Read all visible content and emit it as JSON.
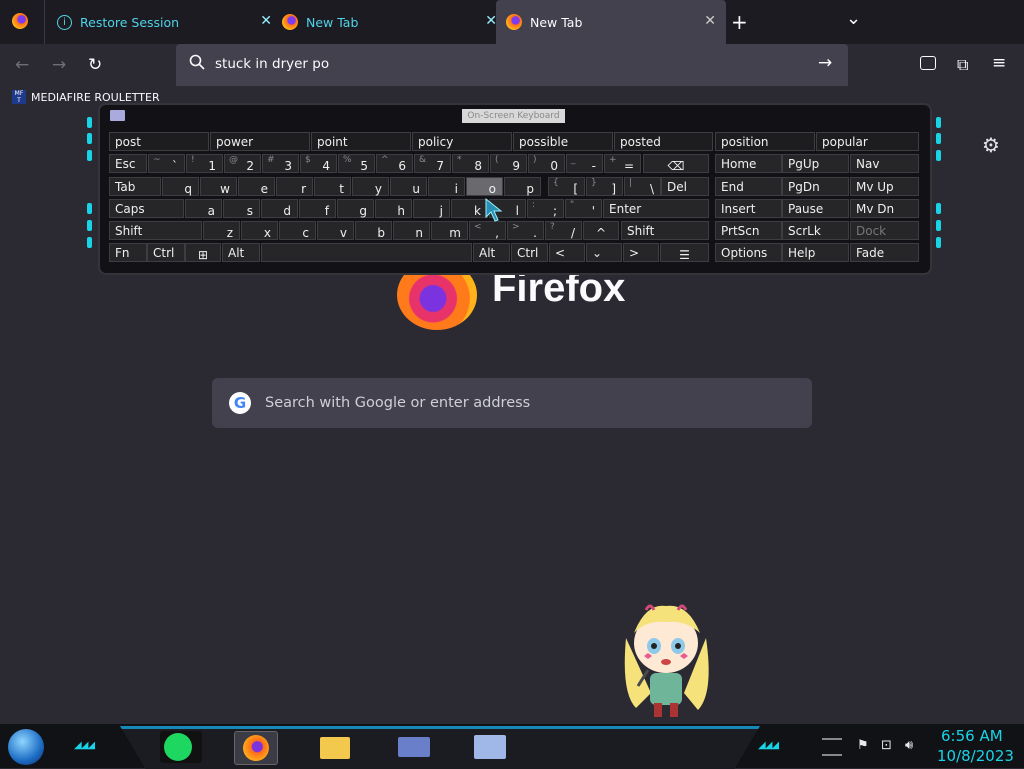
{
  "browser": {
    "tabs": [
      {
        "label": "Restore Session",
        "icon": "info-icon",
        "active": false
      },
      {
        "label": "New Tab",
        "icon": "firefox-icon",
        "active": false
      },
      {
        "label": "New Tab",
        "icon": "firefox-icon",
        "active": true
      }
    ],
    "new_tab": "+",
    "tab_list": "⌄",
    "close_glyph": "✕",
    "address_value": "stuck in dryer po",
    "go_glyph": "→",
    "bookmarks": [
      {
        "label": "MEDIAFIRE ROULETTER",
        "icon_text": "MF T"
      }
    ]
  },
  "keyboard": {
    "title": "On-Screen Keyboard",
    "predictions": [
      "post",
      "power",
      "point",
      "policy",
      "possible",
      "posted",
      "position",
      "popular"
    ],
    "rows": {
      "r1": [
        [
          "~",
          "`"
        ],
        [
          "!",
          "1"
        ],
        [
          "@",
          "2"
        ],
        [
          "#",
          "3"
        ],
        [
          "$",
          "4"
        ],
        [
          "%",
          "5"
        ],
        [
          "^",
          "6"
        ],
        [
          "&",
          "7"
        ],
        [
          "*",
          "8"
        ],
        [
          "(",
          "9"
        ],
        [
          ")",
          "0"
        ],
        [
          "_",
          "-"
        ],
        [
          "+",
          "="
        ]
      ],
      "r2": [
        "q",
        "w",
        "e",
        "r",
        "t",
        "y",
        "u",
        "i",
        "o",
        "p"
      ],
      "r2b": [
        [
          "{",
          "["
        ],
        [
          "}",
          "]"
        ],
        [
          "|",
          "\\"
        ]
      ],
      "r3": [
        "a",
        "s",
        "d",
        "f",
        "g",
        "h",
        "j",
        "k",
        "l"
      ],
      "r3b": [
        [
          ":",
          ";"
        ],
        [
          "\"",
          "'"
        ]
      ],
      "r4": [
        "z",
        "x",
        "c",
        "v",
        "b",
        "n",
        "m"
      ],
      "r4b": [
        [
          "<",
          ","
        ],
        [
          ">",
          "."
        ],
        [
          "?",
          "/"
        ]
      ]
    },
    "labels": {
      "esc": "Esc",
      "tab": "Tab",
      "caps": "Caps",
      "shift": "Shift",
      "fn": "Fn",
      "ctrl": "Ctrl",
      "alt": "Alt",
      "del": "Del",
      "enter": "Enter",
      "shift_r": "Shift",
      "alt_r": "Alt",
      "ctrl_r": "Ctrl",
      "left": "<",
      "down": "⌄",
      "right": ">",
      "up": "^",
      "home": "Home",
      "pgup": "PgUp",
      "nav": "Nav",
      "end": "End",
      "pgdn": "PgDn",
      "mvup": "Mv Up",
      "insert": "Insert",
      "pause": "Pause",
      "mvdn": "Mv Dn",
      "prtscn": "PrtScn",
      "scrlk": "ScrLk",
      "dock": "Dock",
      "options": "Options",
      "help": "Help",
      "fade": "Fade",
      "bksp": "⌫",
      "win": "⊞",
      "menu": "☰"
    }
  },
  "newtab": {
    "brand": "Firefox",
    "search_placeholder": "Search with Google or enter address",
    "google_letter": "G",
    "settings_icon": "gear-icon"
  },
  "taskbar": {
    "time": "6:56 AM",
    "date": "10/8/2023",
    "apps": [
      "spotify-icon",
      "firefox-icon",
      "file-explorer-icon",
      "control-panel-icon",
      "on-screen-keyboard-icon"
    ]
  }
}
